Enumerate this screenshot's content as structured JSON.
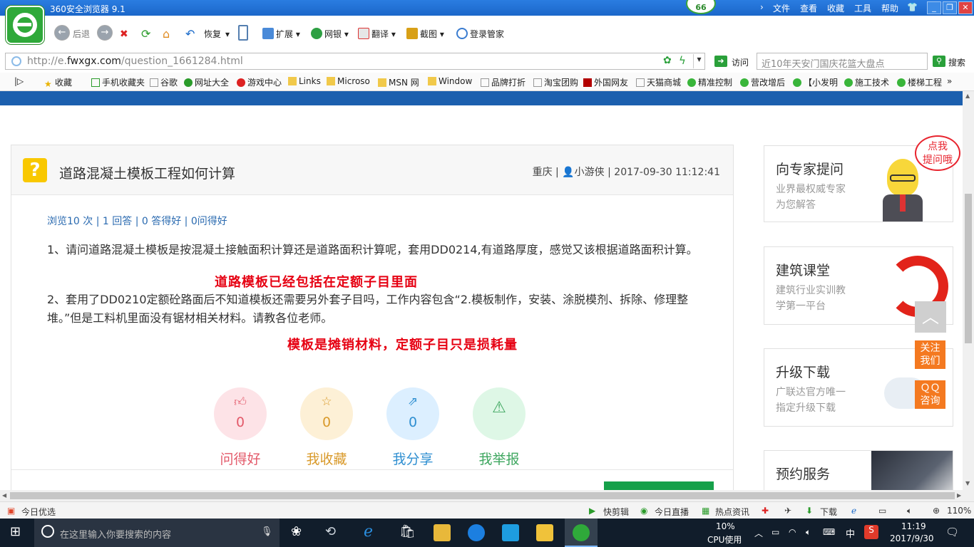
{
  "browser": {
    "title": "360安全浏览器 9.1",
    "badge_count": "66",
    "menu": [
      "文件",
      "查看",
      "收藏",
      "工具",
      "帮助"
    ],
    "toolbar": {
      "back": "后退",
      "restore": "恢复",
      "extend": "扩展",
      "netbank": "网银",
      "translate": "翻译",
      "screenshot": "截图",
      "login": "登录管家"
    },
    "address": {
      "scheme": "http://e.",
      "domain": "fwxgx.com",
      "path": "/question_1661284.html",
      "visit": "访问"
    },
    "search": {
      "placeholder": "近10年天安门国庆花篮大盘点",
      "button": "搜索"
    },
    "bookmarks": [
      "收藏",
      "手机收藏夹",
      "谷歌",
      "网址大全",
      "游戏中心",
      "Links",
      "Microso",
      "MSN 网",
      "Window",
      "品牌打折",
      "淘宝团购",
      "外国网友",
      "天猫商城",
      "精准控制",
      "营改增后",
      "【小发明",
      "施工技术",
      "楼梯工程"
    ]
  },
  "question": {
    "title": "道路混凝土模板工程如何计算",
    "location": "重庆",
    "author": "小游侠",
    "time": "2017-09-30 11:12:41",
    "stats": "浏览10 次 | 1 回答 | 0 答得好 | 0问得好",
    "para1": "1、请问道路混凝土模板是按混凝土接触面积计算还是道路面积计算呢，套用DD0214,有道路厚度，感觉又该根据道路面积计算。",
    "para2": "2、套用了DD0210定额砼路面后不知道模板还需要另外套子目吗，工作内容包含“2.模板制作，安装、涂脱模剂、拆除、修理整堆。”但是工料机里面没有锯材相关材料。请教各位老师。",
    "note1": "道路模板已经包括在定额子目里面",
    "note2": "模板是摊销材料，定额子目只是损耗量",
    "actions": [
      {
        "label": "问得好",
        "count": "0",
        "color": "#e35a6a",
        "bg": "#fde3e7",
        "icon": "thumb-up-icon"
      },
      {
        "label": "我收藏",
        "count": "0",
        "color": "#d99a2b",
        "bg": "#fdf0d6",
        "icon": "star-icon"
      },
      {
        "label": "我分享",
        "count": "0",
        "color": "#2f8fd1",
        "bg": "#dcefff",
        "icon": "share-icon"
      },
      {
        "label": "我举报",
        "count": "",
        "color": "#3fa760",
        "bg": "#def7e6",
        "icon": "warning-icon"
      }
    ]
  },
  "sidebar": {
    "ask": {
      "title": "向专家提问",
      "sub1": "业界最权威专家",
      "sub2": "为您解答",
      "tip": "点我\n提问哦"
    },
    "course": {
      "title": "建筑课堂",
      "sub1": "建筑行业实训教",
      "sub2": "学第一平台"
    },
    "upgrade": {
      "title": "升级下载",
      "sub1": "广联达官方唯一",
      "sub2": "指定升级下载"
    },
    "booking": {
      "title": "预约服务"
    },
    "follow": "关注\n我们",
    "qq": "ＱＱ\n咨询"
  },
  "statusbar": {
    "today": "今日优选",
    "items": [
      "快剪辑",
      "今日直播",
      "热点资讯",
      "下载"
    ],
    "zoom": "110%"
  },
  "taskbar": {
    "search_placeholder": "在这里输入你要搜索的内容",
    "cpu": "10%",
    "cpu_label": "CPU使用",
    "ime": "中",
    "time": "11:19",
    "date": "2017/9/30"
  },
  "colors": {
    "accent_blue": "#1b5fae",
    "question_icon": "#f9c800",
    "red_note": "#e60012",
    "side_orange": "#f47920"
  }
}
